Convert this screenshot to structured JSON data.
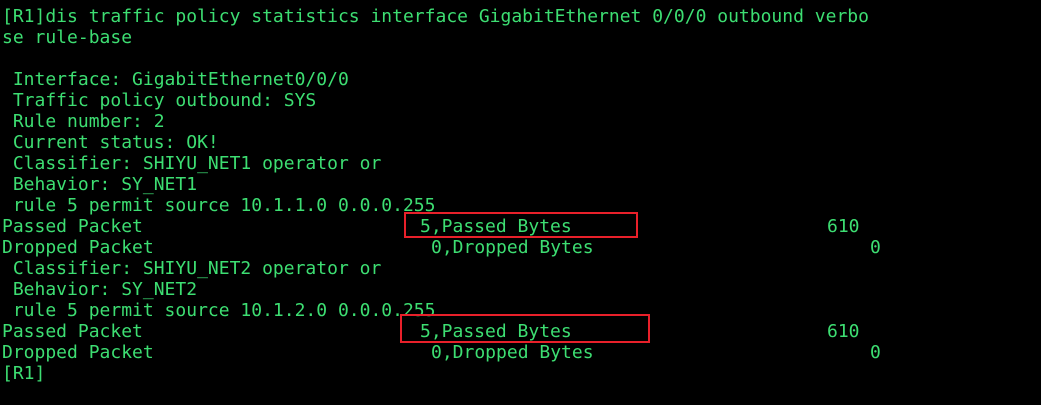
{
  "terminal": {
    "text_color": "#3dde72",
    "background_color": "#000000",
    "highlight_color": "#e8202a",
    "command_line_1": "[R1]dis traffic policy statistics interface GigabitEthernet 0/0/0 outbound verbo",
    "command_line_2": "se rule-base",
    "interface": " Interface: GigabitEthernet0/0/0",
    "policy": " Traffic policy outbound: SYS",
    "rule_number": " Rule number: 2",
    "status": " Current status: OK!",
    "blocks": [
      {
        "classifier": " Classifier: SHIYU_NET1 operator or",
        "behavior": " Behavior: SY_NET1",
        "rule": " rule 5 permit source 10.1.1.0 0.0.0.255",
        "passed_packet_label": "Passed Packet",
        "passed_packet_value": "5,Passed Bytes",
        "passed_bytes_value": "610",
        "dropped_packet_label": "Dropped Packet",
        "dropped_packet_value": "0,Dropped Bytes",
        "dropped_bytes_value": "0"
      },
      {
        "classifier": " Classifier: SHIYU_NET2 operator or",
        "behavior": " Behavior: SY_NET2",
        "rule": " rule 5 permit source 10.1.2.0 0.0.0.255",
        "passed_packet_label": "Passed Packet",
        "passed_packet_value": "5,Passed Bytes",
        "passed_bytes_value": "610",
        "dropped_packet_label": "Dropped Packet",
        "dropped_packet_value": "0,Dropped Bytes",
        "dropped_bytes_value": "0"
      }
    ],
    "prompt": "[R1]"
  }
}
